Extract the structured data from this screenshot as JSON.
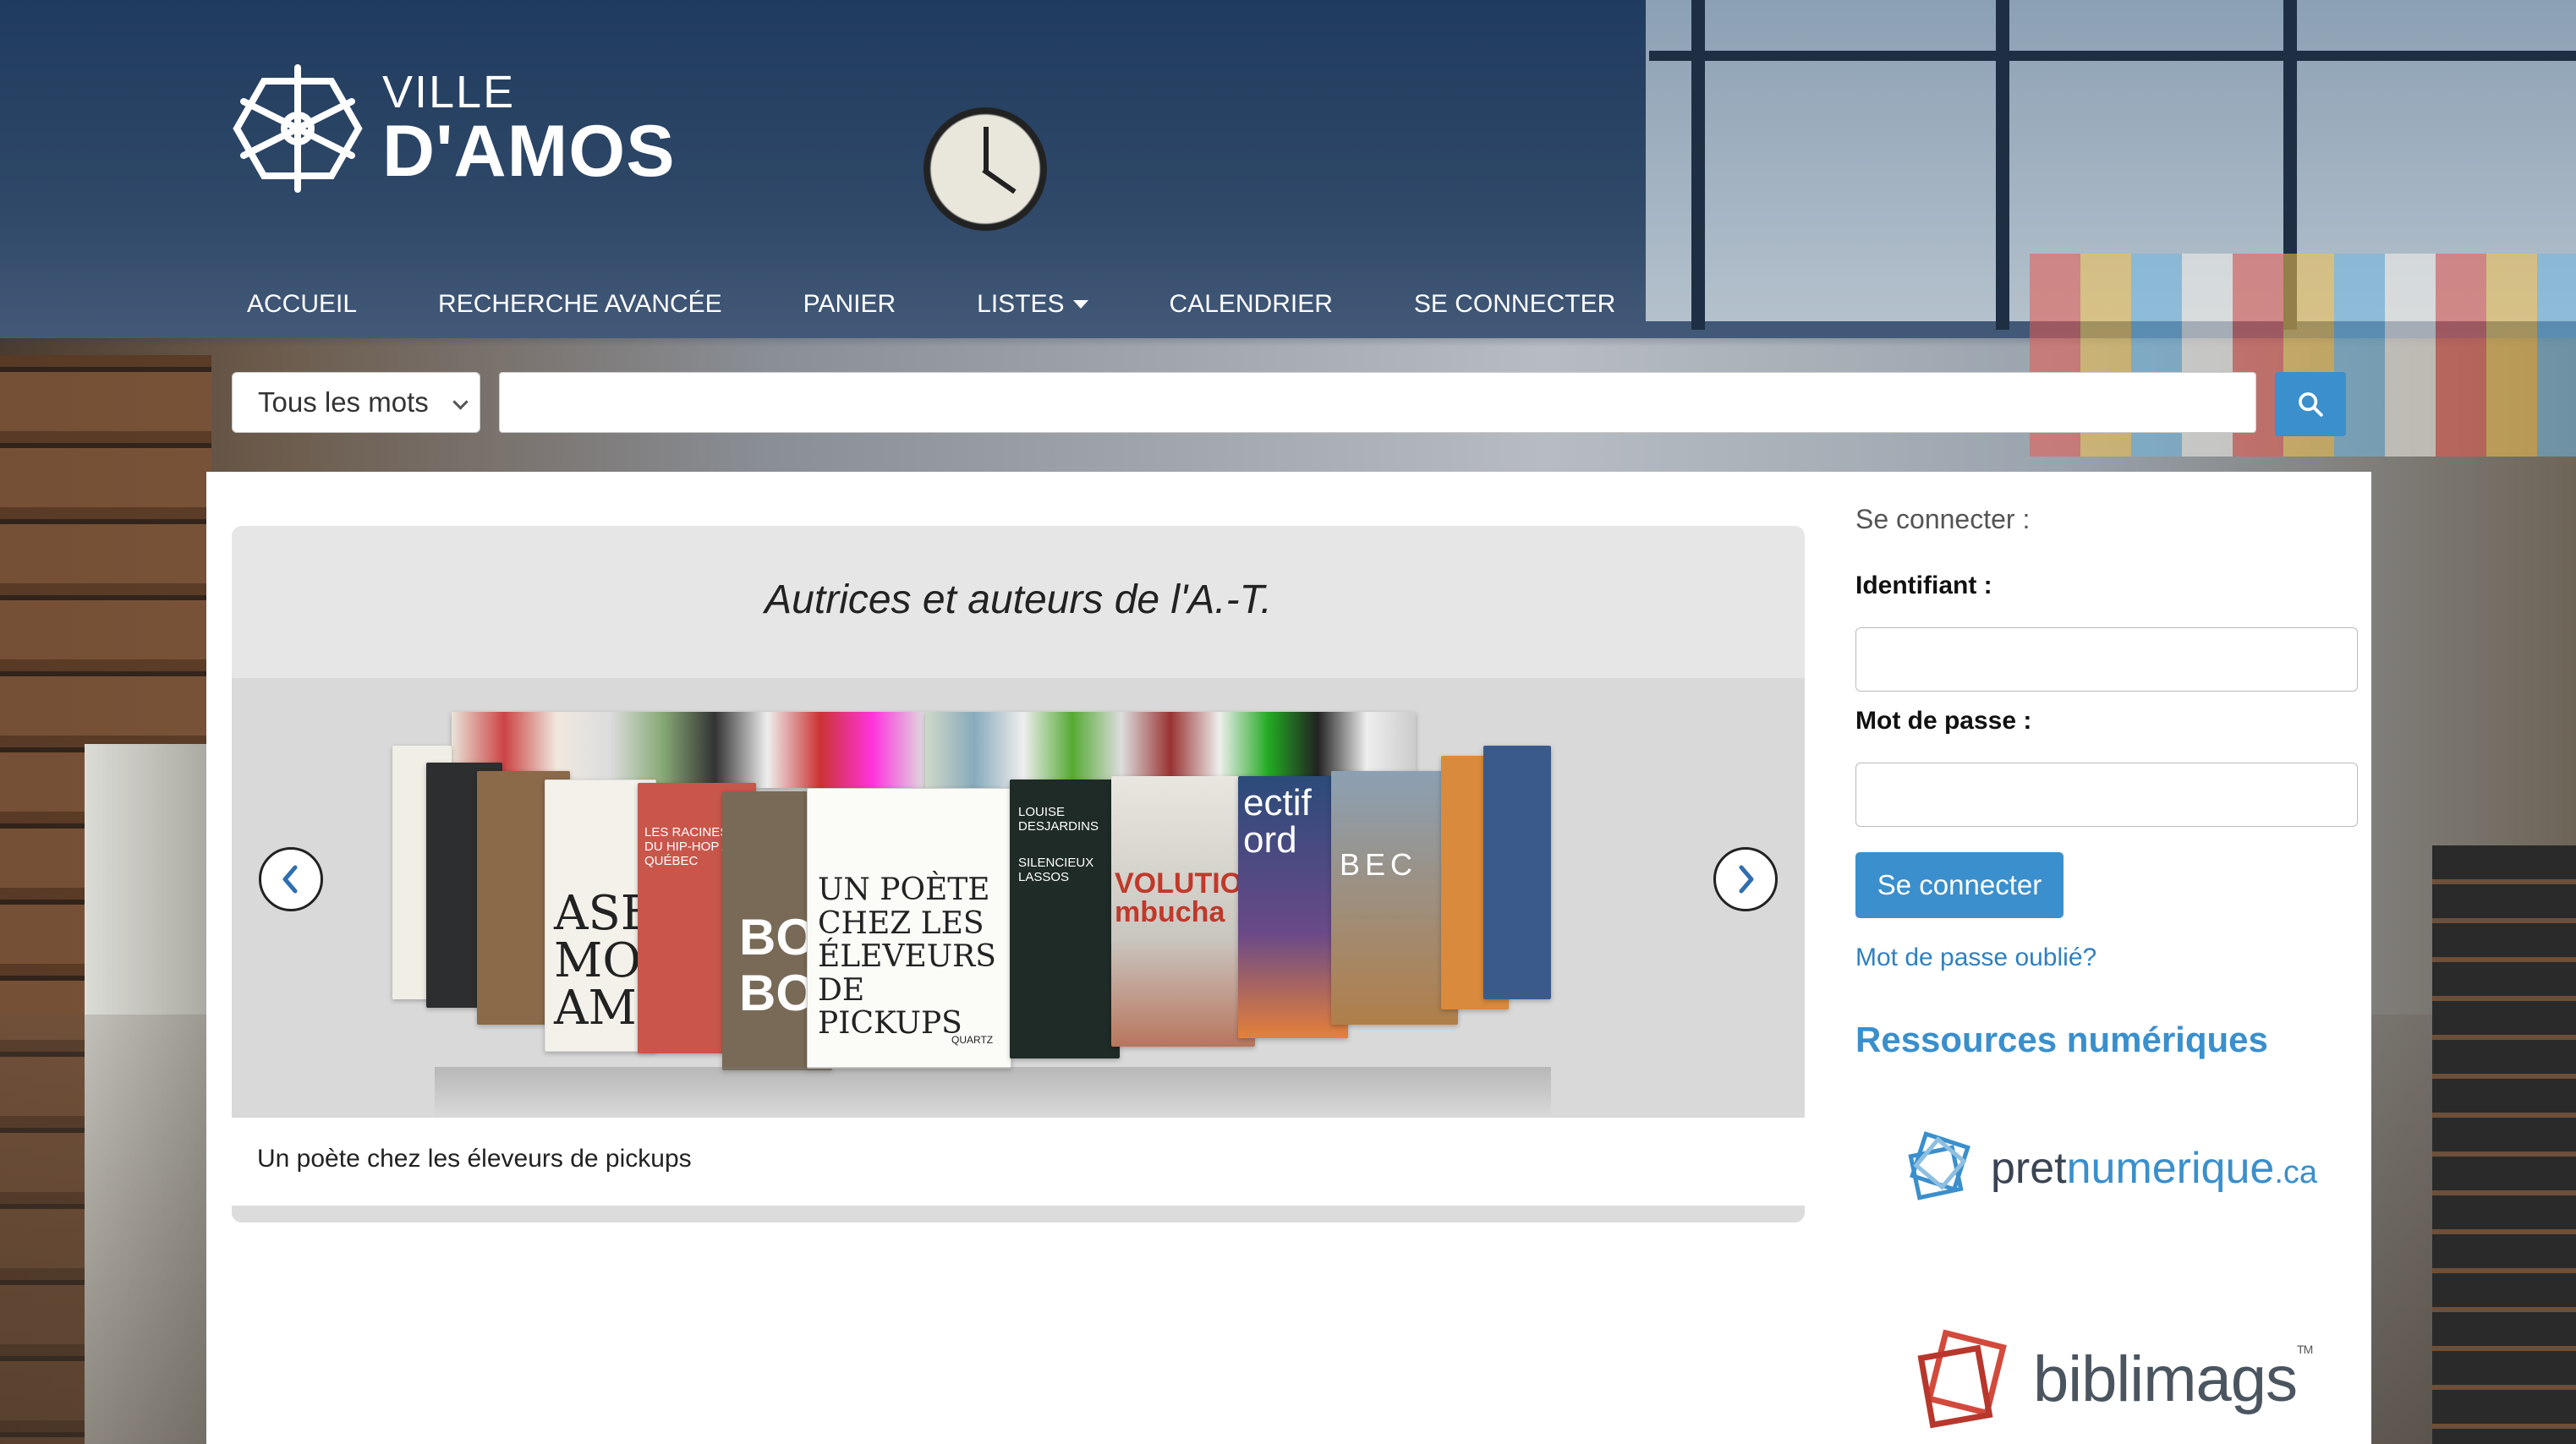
{
  "header": {
    "logo_line1": "VILLE",
    "logo_line2": "D'AMOS"
  },
  "nav": {
    "items": [
      {
        "label": "ACCUEIL"
      },
      {
        "label": "RECHERCHE AVANCÉE"
      },
      {
        "label": "PANIER"
      },
      {
        "label": "LISTES"
      },
      {
        "label": "CALENDRIER"
      },
      {
        "label": "SE CONNECTER"
      }
    ]
  },
  "search": {
    "scope_selected": "Tous les mots",
    "query": ""
  },
  "carousel": {
    "title": "Autrices et auteurs de l'A.-T.",
    "caption": "Un poète chez les éleveurs de pickups",
    "covers": [
      {
        "title": "UN POÈTE CHEZ LES ÉLEVEURS DE PICKUPS"
      },
      {
        "title": "BOO BOO"
      },
      {
        "title": "ASE MON AMO"
      },
      {
        "title": "LES RACINES DU HIP-HOP AU QUÉBEC"
      },
      {
        "title": "SILENCIEUX LASSOS"
      },
      {
        "title": "VOLUTION mbucha"
      },
      {
        "title": "ectif ord"
      },
      {
        "title": "BEC"
      }
    ],
    "cover_authors": [
      "LOUISE DESJARDINS",
      "QUARTZ"
    ]
  },
  "login": {
    "heading": "Se connecter :",
    "username_label": "Identifiant :",
    "password_label": "Mot de passe :",
    "username_value": "",
    "password_value": "",
    "submit_label": "Se connecter",
    "forgot_label": "Mot de passe oublié?"
  },
  "resources": {
    "heading": "Ressources numériques",
    "pretnumerique": {
      "part1": "pret",
      "part2": "numerique",
      "part3": ".ca"
    },
    "biblimags": {
      "text": "biblimags",
      "tm": "TM"
    }
  },
  "colors": {
    "accent": "#3a8fcc",
    "header_overlay": "#1f3b5e"
  }
}
